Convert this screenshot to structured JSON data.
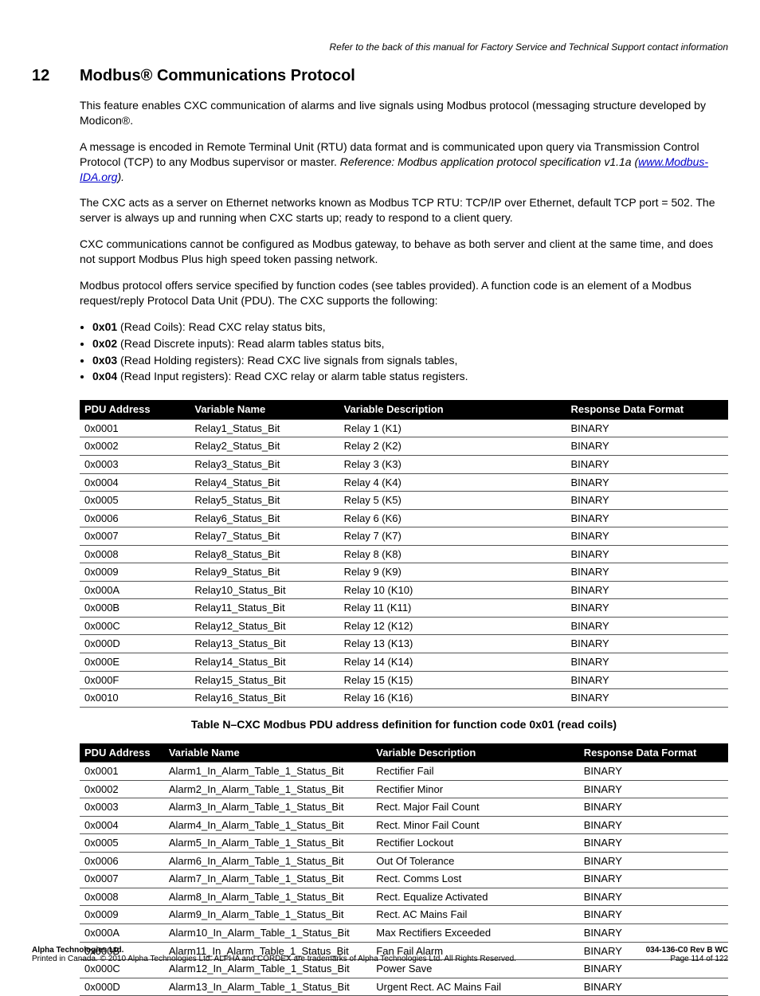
{
  "headerNote": "Refer to the back of this manual for Factory Service and Technical Support contact information",
  "section": {
    "num": "12",
    "title": "Modbus® Communications Protocol"
  },
  "para1": "This feature enables CXC communication of alarms and live signals using Modbus protocol (messaging structure developed by Modicon®.",
  "para2a": "A message is encoded in Remote Terminal Unit (RTU) data format and is communicated upon query via Transmission Control Protocol (TCP) to any Modbus supervisor or master. ",
  "para2b": "Reference: Modbus application protocol specification v1.1a (",
  "para2link": "www.Modbus-IDA.org",
  "para2c": ").",
  "para3": "The CXC acts as a server on Ethernet networks known as Modbus TCP RTU: TCP/IP over Ethernet, default TCP port = 502. The server is always up and running when CXC starts up; ready to respond to a client query.",
  "para4": "CXC communications cannot be configured as Modbus gateway, to behave as both server and client at the same time, and does not support Modbus Plus high speed token passing network.",
  "para5": "Modbus protocol offers service specified by function codes (see tables provided). A function code is an element of a Modbus request/reply Protocol Data Unit (PDU). The CXC supports the following:",
  "bullets": [
    {
      "code": "0x01",
      "text": " (Read Coils): Read CXC relay status bits,"
    },
    {
      "code": "0x02",
      "text": " (Read Discrete inputs): Read alarm tables status bits,"
    },
    {
      "code": "0x03",
      "text": " (Read Holding registers): Read CXC live signals from signals tables,"
    },
    {
      "code": "0x04",
      "text": " (Read Input registers): Read CXC relay or alarm table status registers."
    }
  ],
  "tableHeaders": {
    "pdu": "PDU Address",
    "varName": "Variable Name",
    "varDesc": "Variable Description",
    "respFmt": "Response Data Format"
  },
  "table1Caption": "Table N–CXC Modbus PDU address definition for function code 0x01 (read coils)",
  "table1": [
    {
      "a": "0x0001",
      "n": "Relay1_Status_Bit",
      "d": "Relay 1 (K1)",
      "f": "BINARY"
    },
    {
      "a": "0x0002",
      "n": "Relay2_Status_Bit",
      "d": "Relay 2 (K2)",
      "f": "BINARY"
    },
    {
      "a": "0x0003",
      "n": "Relay3_Status_Bit",
      "d": "Relay 3 (K3)",
      "f": "BINARY"
    },
    {
      "a": "0x0004",
      "n": "Relay4_Status_Bit",
      "d": "Relay 4 (K4)",
      "f": "BINARY"
    },
    {
      "a": "0x0005",
      "n": "Relay5_Status_Bit",
      "d": "Relay 5 (K5)",
      "f": "BINARY"
    },
    {
      "a": "0x0006",
      "n": "Relay6_Status_Bit",
      "d": "Relay 6 (K6)",
      "f": "BINARY"
    },
    {
      "a": "0x0007",
      "n": "Relay7_Status_Bit",
      "d": "Relay 7 (K7)",
      "f": "BINARY"
    },
    {
      "a": "0x0008",
      "n": "Relay8_Status_Bit",
      "d": "Relay 8 (K8)",
      "f": "BINARY"
    },
    {
      "a": "0x0009",
      "n": "Relay9_Status_Bit",
      "d": "Relay 9 (K9)",
      "f": "BINARY"
    },
    {
      "a": "0x000A",
      "n": "Relay10_Status_Bit",
      "d": "Relay 10 (K10)",
      "f": "BINARY"
    },
    {
      "a": "0x000B",
      "n": "Relay11_Status_Bit",
      "d": "Relay 11 (K11)",
      "f": "BINARY"
    },
    {
      "a": "0x000C",
      "n": "Relay12_Status_Bit",
      "d": "Relay 12 (K12)",
      "f": "BINARY"
    },
    {
      "a": "0x000D",
      "n": "Relay13_Status_Bit",
      "d": "Relay 13 (K13)",
      "f": "BINARY"
    },
    {
      "a": "0x000E",
      "n": "Relay14_Status_Bit",
      "d": "Relay 14 (K14)",
      "f": "BINARY"
    },
    {
      "a": "0x000F",
      "n": "Relay15_Status_Bit",
      "d": "Relay 15 (K15)",
      "f": "BINARY"
    },
    {
      "a": "0x0010",
      "n": "Relay16_Status_Bit",
      "d": "Relay 16 (K16)",
      "f": "BINARY"
    }
  ],
  "table2": [
    {
      "a": "0x0001",
      "n": "Alarm1_In_Alarm_Table_1_Status_Bit",
      "d": "Rectifier Fail",
      "f": "BINARY"
    },
    {
      "a": "0x0002",
      "n": "Alarm2_In_Alarm_Table_1_Status_Bit",
      "d": "Rectifier Minor",
      "f": "BINARY"
    },
    {
      "a": "0x0003",
      "n": "Alarm3_In_Alarm_Table_1_Status_Bit",
      "d": "Rect. Major Fail Count",
      "f": "BINARY"
    },
    {
      "a": "0x0004",
      "n": "Alarm4_In_Alarm_Table_1_Status_Bit",
      "d": "Rect. Minor Fail Count",
      "f": "BINARY"
    },
    {
      "a": "0x0005",
      "n": "Alarm5_In_Alarm_Table_1_Status_Bit",
      "d": "Rectifier Lockout",
      "f": "BINARY"
    },
    {
      "a": "0x0006",
      "n": "Alarm6_In_Alarm_Table_1_Status_Bit",
      "d": "Out Of Tolerance",
      "f": "BINARY"
    },
    {
      "a": "0x0007",
      "n": "Alarm7_In_Alarm_Table_1_Status_Bit",
      "d": "Rect. Comms Lost",
      "f": "BINARY"
    },
    {
      "a": "0x0008",
      "n": "Alarm8_In_Alarm_Table_1_Status_Bit",
      "d": "Rect. Equalize Activated",
      "f": "BINARY"
    },
    {
      "a": "0x0009",
      "n": "Alarm9_In_Alarm_Table_1_Status_Bit",
      "d": "Rect. AC Mains Fail",
      "f": "BINARY"
    },
    {
      "a": "0x000A",
      "n": "Alarm10_In_Alarm_Table_1_Status_Bit",
      "d": "Max Rectifiers Exceeded",
      "f": "BINARY"
    },
    {
      "a": "0x000B",
      "n": "Alarm11_In_Alarm_Table_1_Status_Bit",
      "d": "Fan Fail Alarm",
      "f": "BINARY"
    },
    {
      "a": "0x000C",
      "n": "Alarm12_In_Alarm_Table_1_Status_Bit",
      "d": "Power Save",
      "f": "BINARY"
    },
    {
      "a": "0x000D",
      "n": "Alarm13_In_Alarm_Table_1_Status_Bit",
      "d": "Urgent Rect. AC Mains Fail",
      "f": "BINARY"
    }
  ],
  "footer": {
    "company": "Alpha Technologies Ltd.",
    "copyright": "Printed in Canada.  © 2010 Alpha Technologies Ltd. ALPHA and CORDEX are trademarks of Alpha Technologies Ltd.  All Rights Reserved.",
    "docnum": "034-136-C0  Rev B  WC",
    "pageinfo": "Page 114 of 122"
  },
  "colWidths": {
    "t1": {
      "c1": "17%",
      "c2": "23%",
      "c3": "35%",
      "c4": "25%"
    },
    "t2": {
      "c1": "13%",
      "c2": "32%",
      "c3": "32%",
      "c4": "23%"
    }
  }
}
